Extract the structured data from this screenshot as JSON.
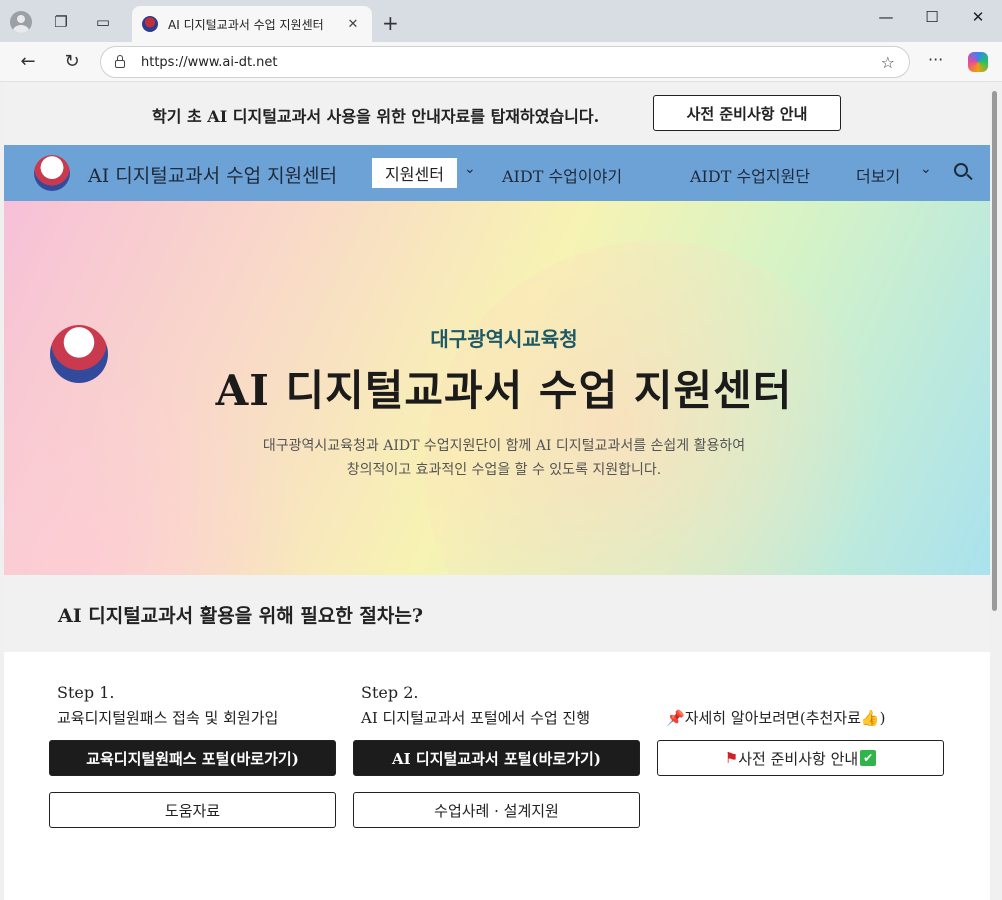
{
  "browser": {
    "tab_title": "AI 디지털교과서 수업 지원센터",
    "url": "https://www.ai-dt.net"
  },
  "announcement": {
    "text": "학기 초 AI 디지털교과서 사용을 위한 안내자료를 탑재하였습니다.",
    "button": "사전 준비사항 안내"
  },
  "nav": {
    "site_title": "AI 디지털교과서 수업 지원센터",
    "items": [
      "지원센터",
      "AIDT 수업이야기",
      "AIDT 수업지원단",
      "더보기"
    ]
  },
  "hero": {
    "subtitle": "대구광역시교육청",
    "title": "AI 디지털교과서 수업 지원센터",
    "desc_line1": "대구광역시교육청과 AIDT 수업지원단이 함께 AI 디지털교과서를 손쉽게 활용하여",
    "desc_line2": "창의적이고 효과적인 수업을 할 수 있도록 지원합니다."
  },
  "procedure": {
    "title": "AI 디지털교과서 활용을 위해 필요한 절차는?",
    "step1": {
      "step": "Step 1.",
      "label": "교육디지털원패스 접속 및 회원가입",
      "primary": "교육디지털원패스 포털(바로가기)",
      "secondary": "도움자료"
    },
    "step2": {
      "step": "Step 2.",
      "label": "AI 디지털교과서 포털에서 수업 진행",
      "primary": "AI 디지털교과서 포털(바로가기)",
      "secondary": "수업사례 · 설계지원"
    },
    "more": {
      "label": "자세히 알아보려면(추천자료",
      "label_end": ")",
      "button": "사전 준비사항 안내"
    }
  },
  "colors": {
    "nav_bg": "#6da2d6",
    "dark_button": "#1c1c1c",
    "hero_subtitle": "#1e5a66"
  },
  "icons": [
    "pushpin-icon",
    "thumbs-up-icon",
    "red-flag-icon",
    "check-mark-icon",
    "search-icon"
  ]
}
